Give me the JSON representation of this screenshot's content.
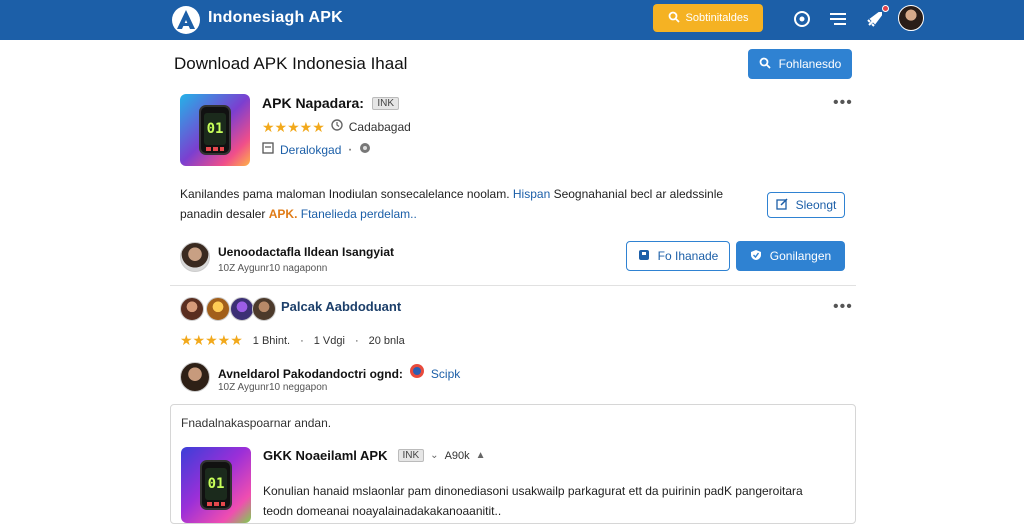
{
  "header": {
    "brand": "Indonesiagh APK",
    "search_label": "Sobtinitaldes",
    "icons": [
      "app-logo-icon",
      "search-icon",
      "compass-icon",
      "menu-icon",
      "rocket-icon",
      "user-avatar"
    ],
    "accent": "#1c5fa8",
    "search_color": "#f5b223"
  },
  "page": {
    "title": "Download APK Indonesia Ihaal",
    "top_button": "Fohlanesdo"
  },
  "app": {
    "name": "APK Napadara:",
    "badge": "INK",
    "rating_stars": 5,
    "rating_note": "Cadabagad",
    "category": "Deralokgad",
    "description_1": "Kanilandes pama maloman Inodiulan sonsecalelance noolam.",
    "description_link": "Hispan",
    "description_2": " Seognahanial becl ar aledssinle",
    "description_3a": "panadin desaler",
    "description_orange": "APK.",
    "description_link2": "Ftanelieda perdelam..",
    "share_button": "Sleongt",
    "icon_digits": "01"
  },
  "author": {
    "name": "Uenoodactafla Ildean Isangyiat",
    "sub": "10Z Aygunr10 nagaponn",
    "btn_outline": "Fo Ihanade",
    "btn_primary": "Gonilangen"
  },
  "reviews": {
    "title": "Palcak Aabdoduant",
    "rating_stars": 5,
    "stat_1": "1 Bhint.",
    "stat_2": "1 Vdgi",
    "stat_3": "20 bnla",
    "reviewer": "Avneldarol Pakodandoctri ognd:",
    "reviewer_tag": "Scipk",
    "reviewer_sub": "10Z Aygunr10 neggapon"
  },
  "card": {
    "heading": "Fnadalnakaspoarnar andan.",
    "app_name": "GKK Noaeilaml APK",
    "badge": "INK",
    "size": "A90k",
    "desc_1": "Konulian hanaid mslaonlar pam dinonediasoni usakwailp parkagurat ett da puirinin padK pangeroitara",
    "desc_2": "teodn domeanai noayalainadakakanoaanitit..",
    "icon_digits": "01"
  }
}
